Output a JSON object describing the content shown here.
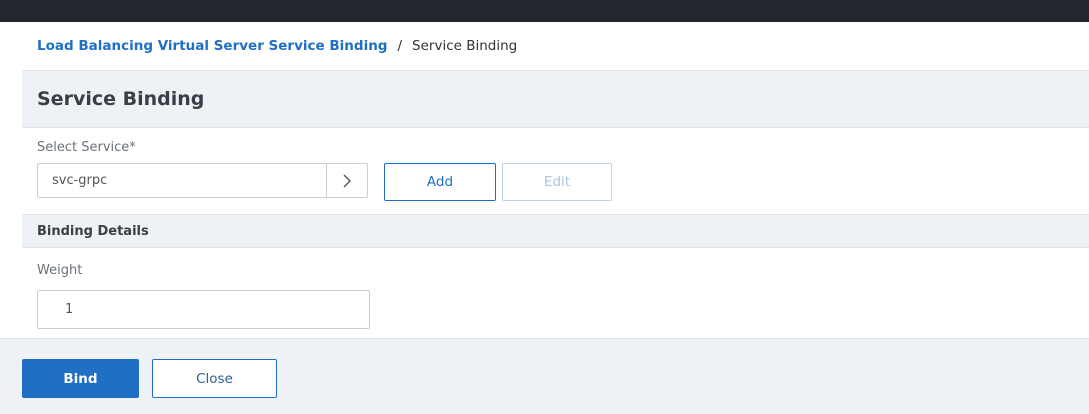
{
  "breadcrumb": {
    "parent": "Load Balancing Virtual Server Service Binding",
    "separator": "/",
    "current": "Service Binding"
  },
  "page": {
    "title": "Service Binding"
  },
  "select_service": {
    "label": "Select Service*",
    "value": "svc-grpc",
    "arrow_icon": "chevron-right-icon",
    "add_label": "Add",
    "edit_label": "Edit"
  },
  "binding_details": {
    "header": "Binding Details",
    "weight_label": "Weight",
    "weight_value": "1"
  },
  "footer": {
    "bind_label": "Bind",
    "close_label": "Close"
  },
  "colors": {
    "accent": "#1f6fc5",
    "topbar": "#22262d",
    "section_bg": "#eef1f5"
  }
}
